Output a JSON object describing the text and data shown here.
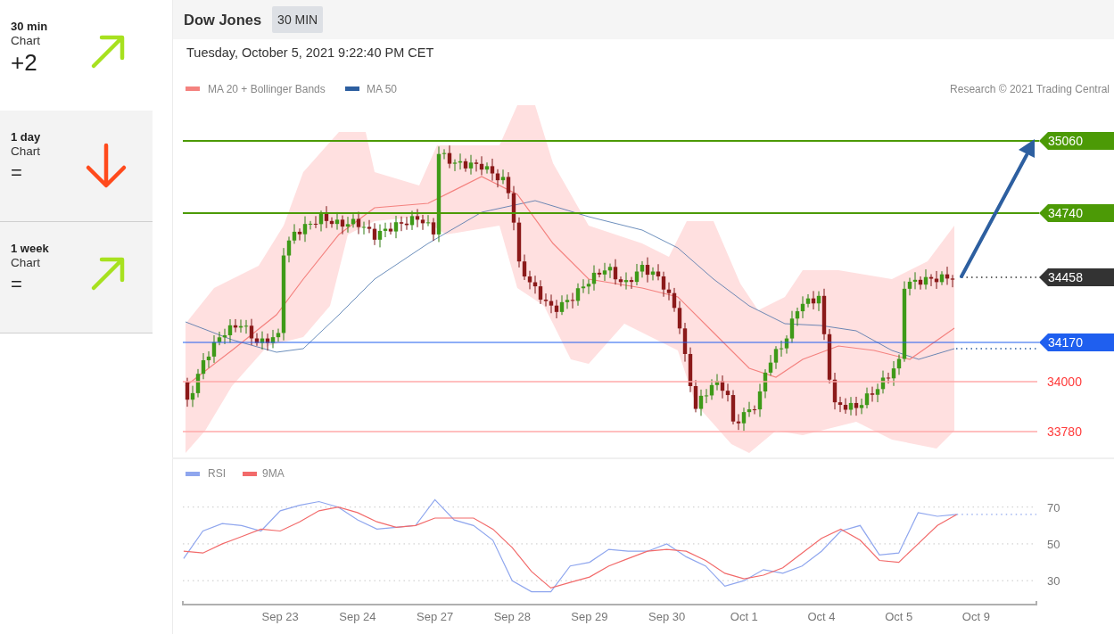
{
  "sidebar": {
    "items": [
      {
        "timeframe": "30 min",
        "label": "Chart",
        "score": "+2",
        "kind": "up",
        "selected": true
      },
      {
        "timeframe": "1 day",
        "label": "Chart",
        "score": "=",
        "kind": "down",
        "selected": false
      },
      {
        "timeframe": "1 week",
        "label": "Chart",
        "score": "=",
        "kind": "up",
        "selected": false
      }
    ]
  },
  "header": {
    "instrument": "Dow Jones",
    "interval": "30 MIN"
  },
  "timestamp": "Tuesday, October 5, 2021 9:22:40 PM CET",
  "price_chart": {
    "legend": [
      {
        "label": "MA 20 + Bollinger Bands",
        "color": "#f4827f"
      },
      {
        "label": "MA 50",
        "color": "#2d5fa0"
      }
    ],
    "credit": "Research © 2021 Trading Central",
    "levels": [
      {
        "value": "35060",
        "kind": "resistance"
      },
      {
        "value": "34740",
        "kind": "resistance"
      },
      {
        "value": "34458",
        "kind": "last"
      },
      {
        "value": "34170",
        "kind": "pivot"
      },
      {
        "value": "34000",
        "kind": "support"
      },
      {
        "value": "33780",
        "kind": "support"
      }
    ]
  },
  "rsi_panel": {
    "chart_data": {
      "type": "line",
      "categories": [
        null,
        null,
        null,
        null,
        null,
        "Sep 23",
        null,
        null,
        null,
        "Sep 24",
        null,
        null,
        null,
        "Sep 27",
        null,
        null,
        null,
        "Sep 28",
        null,
        null,
        null,
        "Sep 29",
        null,
        null,
        null,
        "Sep 30",
        null,
        null,
        null,
        "Oct 1",
        null,
        null,
        null,
        "Oct 4",
        null,
        null,
        null,
        "Oct 5",
        null,
        null,
        null,
        "Oct 9"
      ],
      "series": [
        {
          "name": "RSI",
          "color": "#8fa6ee",
          "values": [
            42,
            57,
            61,
            60,
            57,
            68,
            71,
            73,
            70,
            63,
            58,
            59,
            60,
            74,
            63,
            60,
            52,
            30,
            24,
            24,
            38,
            40,
            47,
            46,
            46,
            50,
            43,
            38,
            27,
            30,
            36,
            34,
            38,
            46,
            57,
            60,
            44,
            45,
            67,
            65,
            66,
            null
          ]
        },
        {
          "name": "9MA",
          "color": "#f26a6a",
          "values": [
            46,
            45,
            50,
            54,
            58,
            57,
            62,
            68,
            70,
            67,
            62,
            59,
            60,
            64,
            64,
            64,
            58,
            48,
            35,
            26,
            29,
            32,
            38,
            42,
            46,
            47,
            46,
            41,
            34,
            31,
            33,
            37,
            45,
            53,
            58,
            52,
            41,
            40,
            50,
            60,
            66,
            null
          ]
        }
      ],
      "ylim": [
        17,
        96.5
      ],
      "yticks": [
        30,
        50,
        70
      ],
      "grid": true,
      "legend": "upper left"
    }
  }
}
